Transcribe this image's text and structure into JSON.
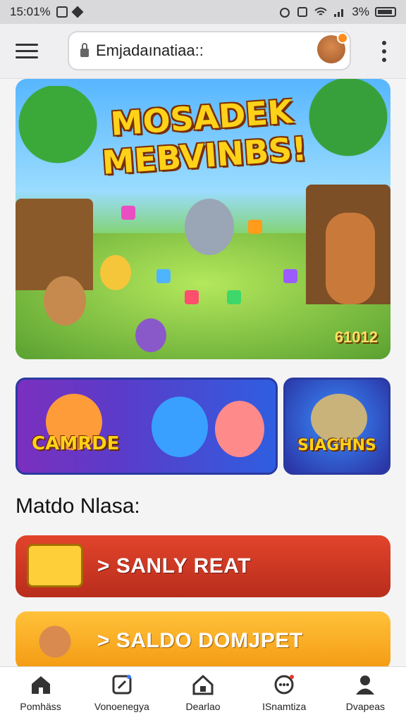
{
  "status_bar": {
    "time": "15:01%",
    "battery": "3%"
  },
  "app_bar": {
    "search_text": "Emjadaınatiaa::"
  },
  "hero": {
    "title_line1": "MOSADEK",
    "title_line2": "MEBVINBS!",
    "coin_value": "61012"
  },
  "cards": [
    {
      "label": "CAMRDE"
    },
    {
      "label": "SIAGHNS"
    }
  ],
  "section": {
    "title": "Matdo Nlasa:"
  },
  "buttons": [
    {
      "label": "> SANLY REAT"
    },
    {
      "label": "> SALDO DOMJPET"
    }
  ],
  "tabs": [
    {
      "label": "Pomhäss",
      "icon": "home-icon"
    },
    {
      "label": "Vonoenegya",
      "icon": "edit-icon"
    },
    {
      "label": "Dearlao",
      "icon": "house-icon"
    },
    {
      "label": "ISnamtiza",
      "icon": "chat-icon"
    },
    {
      "label": "Dvapeas",
      "icon": "user-icon"
    }
  ],
  "colors": {
    "primary_red": "#d63b24",
    "primary_orange": "#f7a81c",
    "accent_yellow": "#ffd21a"
  }
}
